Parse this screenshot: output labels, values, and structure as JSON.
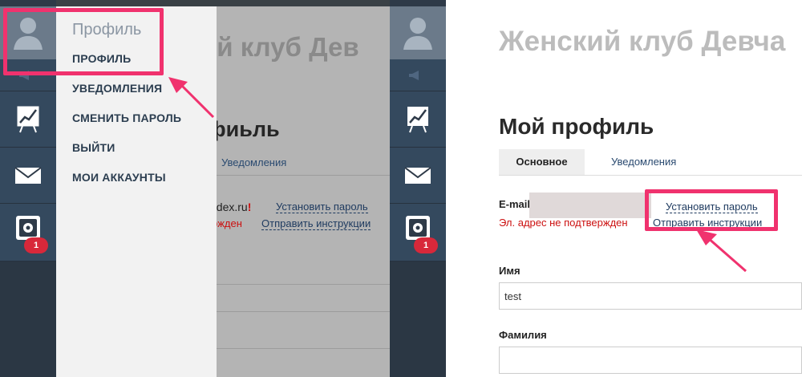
{
  "left": {
    "bg_title": "ий клуб Дев",
    "bg_profile_heading": "фиьль",
    "bg_tab_notifications": "Уведомления",
    "bg_email_tail": "ndex.ru",
    "bg_email_flag": "!",
    "bg_set_password": "Установить пароль",
    "bg_send_instructions": "Отправить инструкции",
    "bg_error_tail": "ржден",
    "badge_count": "1",
    "menu": {
      "title": "Профиль",
      "items": [
        {
          "label": "ПРОФИЛЬ"
        },
        {
          "label": "УВЕДОМЛЕНИЯ"
        },
        {
          "label": "СМЕНИТЬ ПАРОЛЬ"
        },
        {
          "label": "ВЫЙТИ"
        },
        {
          "label": "МОИ АККАУНТЫ"
        }
      ]
    }
  },
  "right": {
    "site_title": "Женский клуб Девча",
    "page_heading": "Мой профиль",
    "tabs": [
      {
        "label": "Основное",
        "active": true
      },
      {
        "label": "Уведомления",
        "active": false
      }
    ],
    "email": {
      "label": "E-mail:",
      "error": "Эл. адрес не подтвержден",
      "set_password": "Установить пароль",
      "send_instructions": "Отправить инструкции"
    },
    "fields": [
      {
        "label": "Имя",
        "value": "test"
      },
      {
        "label": "Фамилия",
        "value": ""
      }
    ],
    "badge_count": "1"
  },
  "colors": {
    "highlight": "#f0326e",
    "rail": "#2e3a48",
    "link": "#1e3a5f",
    "error": "#cc1111"
  },
  "icons": [
    "avatar-icon",
    "sound-icon",
    "chart-icon",
    "mail-icon",
    "safe-icon"
  ]
}
